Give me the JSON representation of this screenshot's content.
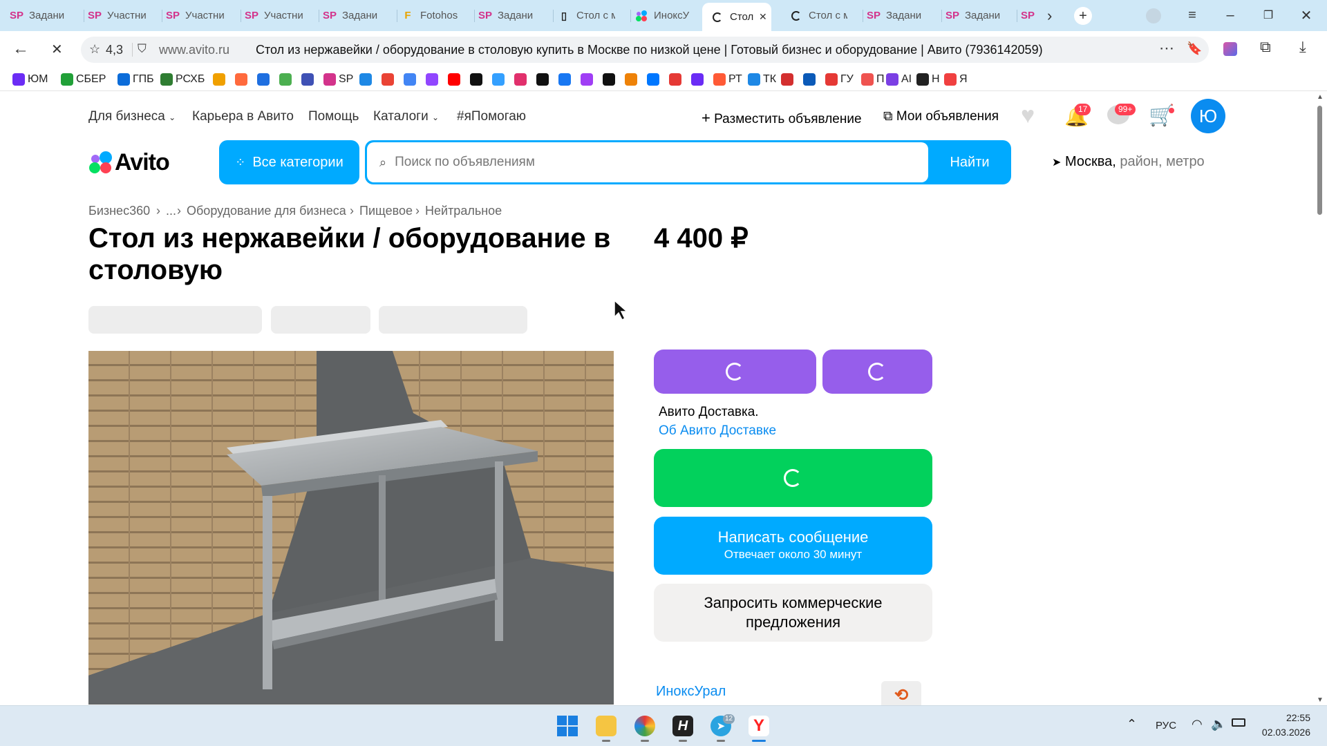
{
  "browser": {
    "tabs": [
      {
        "icon": "SP",
        "title": "Задани"
      },
      {
        "icon": "SP",
        "title": "Участни"
      },
      {
        "icon": "SP",
        "title": "Участни"
      },
      {
        "icon": "SP",
        "title": "Участни"
      },
      {
        "icon": "SP",
        "title": "Задани"
      },
      {
        "icon": "F",
        "title": "Fotohos"
      },
      {
        "icon": "SP",
        "title": "Задани"
      },
      {
        "icon": "doc",
        "title": "Стол с м"
      },
      {
        "icon": "avito",
        "title": "ИноксУ"
      },
      {
        "icon": "loading",
        "title": "Стол"
      },
      {
        "icon": "loading",
        "title": "Стол с м"
      },
      {
        "icon": "SP",
        "title": "Задани"
      },
      {
        "icon": "SP",
        "title": "Задани"
      },
      {
        "icon": "SP",
        "title": ""
      }
    ],
    "rating": "4,3",
    "domain": "www.avito.ru",
    "page_title": "Стол из нержавейки / оборудование в столовую купить в Москве по низкой цене | Готовый бизнес и оборудование | Авито (7936142059)",
    "bookmarks": [
      "ЮМ",
      "СБЕР",
      "ГПБ",
      "РСХБ",
      "",
      "",
      "",
      "",
      "",
      "SP",
      "",
      "",
      "",
      "",
      "",
      "",
      "",
      "",
      "",
      "",
      "",
      "",
      "",
      "",
      "",
      "",
      "РТ",
      "ТК",
      "",
      "",
      "ГУ",
      "П",
      "AI",
      "Н",
      "Я"
    ]
  },
  "site": {
    "nav": {
      "business": "Для бизнеса",
      "career": "Карьера в Авито",
      "help": "Помощь",
      "catalogs": "Каталоги",
      "ihelp": "#яПомогаю",
      "post_ad": "Разместить объявление",
      "my_ads": "Мои объявления",
      "notif_count": "17",
      "msg_count": "99+",
      "avatar_letter": "Ю"
    },
    "logo": "Avito",
    "all_categories": "Все категории",
    "search_placeholder": "Поиск по объявлениям",
    "find_button": "Найти",
    "location_city": "Москва,",
    "location_rest": " район, метро"
  },
  "listing": {
    "breadcrumbs": [
      "Бизнес360",
      "...",
      "Оборудование для бизнеса",
      "Пищевое",
      "Нейтральное"
    ],
    "title": "Стол из нержавейки / оборудование в столовую",
    "price": "4 400 ₽",
    "delivery_text": "Авито Доставка.",
    "delivery_link": "Об Авито Доставке",
    "message_button": "Написать сообщение",
    "message_sub": "Отвечает около 30 минут",
    "request_offers": "Запросить коммерческие предложения",
    "seller_name": "ИноксУрал"
  },
  "taskbar": {
    "telegram_badge": "12",
    "lang": "РУС",
    "time": "22:55",
    "date": "02.03.2026"
  },
  "colors": {
    "accent_blue": "#00aaff",
    "purple": "#965eeb",
    "green": "#02d15c",
    "tab_bar": "#cfe8f7"
  }
}
